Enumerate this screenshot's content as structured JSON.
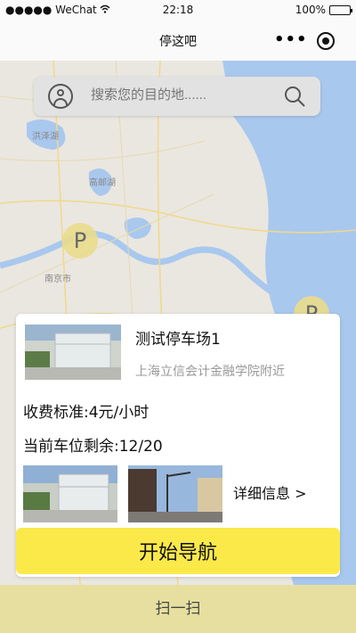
{
  "status_bar": {
    "carrier": "●●●●● WeChat",
    "time": "22:18",
    "battery": "100%"
  },
  "nav": {
    "title": "停这吧",
    "more": "•••"
  },
  "search": {
    "placeholder": "搜索您的目的地......"
  },
  "map": {
    "labels": [
      "洪泽湖",
      "高邮湖",
      "南京市"
    ],
    "marker_label": "P"
  },
  "card": {
    "lot_name": "测试停车场1",
    "address": "上海立信会计金融学院附近",
    "fee": "收费标准:4元/小时",
    "spaces": "当前车位剩余:12/20",
    "detail": "详细信息 >",
    "navigate": "开始导航"
  },
  "bottom": {
    "scan": "扫一扫"
  },
  "colors": {
    "accent": "#fbe94a",
    "bottom_bar": "#e7dfa0",
    "marker": "#eadc8c"
  }
}
